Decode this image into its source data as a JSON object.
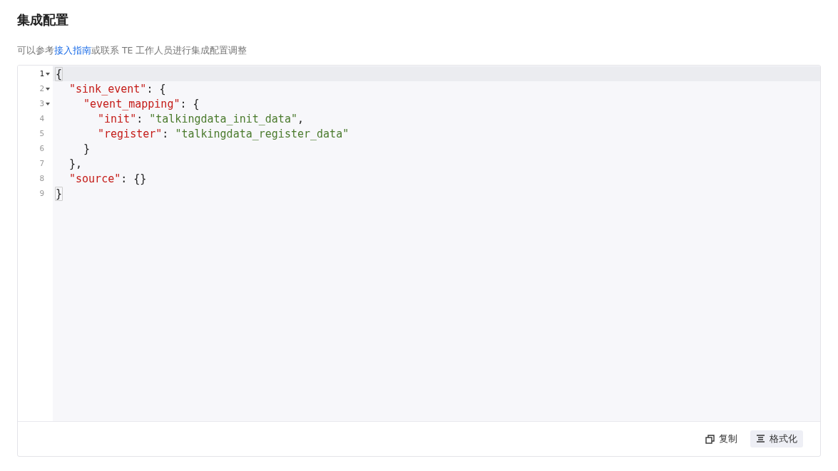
{
  "title": "集成配置",
  "description": [
    {
      "kind": "text",
      "text": "可以参考"
    },
    {
      "kind": "link",
      "text": "接入指南"
    },
    {
      "kind": "text",
      "text": "或联系 TE 工作人员进行集成配置调整"
    }
  ],
  "editor": {
    "lines": [
      {
        "number": "1",
        "foldable": true,
        "active": true,
        "tokens": [
          {
            "kind": "bracket",
            "text": "{"
          }
        ]
      },
      {
        "number": "2",
        "foldable": true,
        "active": false,
        "tokens": [
          {
            "kind": "key",
            "text": "\"sink_event\""
          },
          {
            "kind": "punct",
            "text": ": {"
          }
        ]
      },
      {
        "number": "3",
        "foldable": true,
        "active": false,
        "tokens": [
          {
            "kind": "key",
            "text": "\"event_mapping\""
          },
          {
            "kind": "punct",
            "text": ": {"
          }
        ]
      },
      {
        "number": "4",
        "foldable": false,
        "active": false,
        "tokens": [
          {
            "kind": "key",
            "text": "\"init\""
          },
          {
            "kind": "punct",
            "text": ": "
          },
          {
            "kind": "string",
            "text": "\"talkingdata_init_data\""
          },
          {
            "kind": "punct",
            "text": ","
          }
        ]
      },
      {
        "number": "5",
        "foldable": false,
        "active": false,
        "tokens": [
          {
            "kind": "key",
            "text": "\"register\""
          },
          {
            "kind": "punct",
            "text": ": "
          },
          {
            "kind": "string",
            "text": "\"talkingdata_register_data\""
          }
        ]
      },
      {
        "number": "6",
        "foldable": false,
        "active": false,
        "tokens": [
          {
            "kind": "punct",
            "text": "}"
          }
        ]
      },
      {
        "number": "7",
        "foldable": false,
        "active": false,
        "tokens": [
          {
            "kind": "punct",
            "text": "},"
          }
        ]
      },
      {
        "number": "8",
        "foldable": false,
        "active": false,
        "tokens": [
          {
            "kind": "key",
            "text": "\"source\""
          },
          {
            "kind": "punct",
            "text": ": {}"
          }
        ]
      },
      {
        "number": "9",
        "foldable": false,
        "active": false,
        "tokens": [
          {
            "kind": "bracket",
            "text": "}"
          }
        ]
      }
    ]
  },
  "buttons": [
    {
      "kind": "copy",
      "label": "复制"
    },
    {
      "kind": "format",
      "label": "格式化"
    }
  ]
}
